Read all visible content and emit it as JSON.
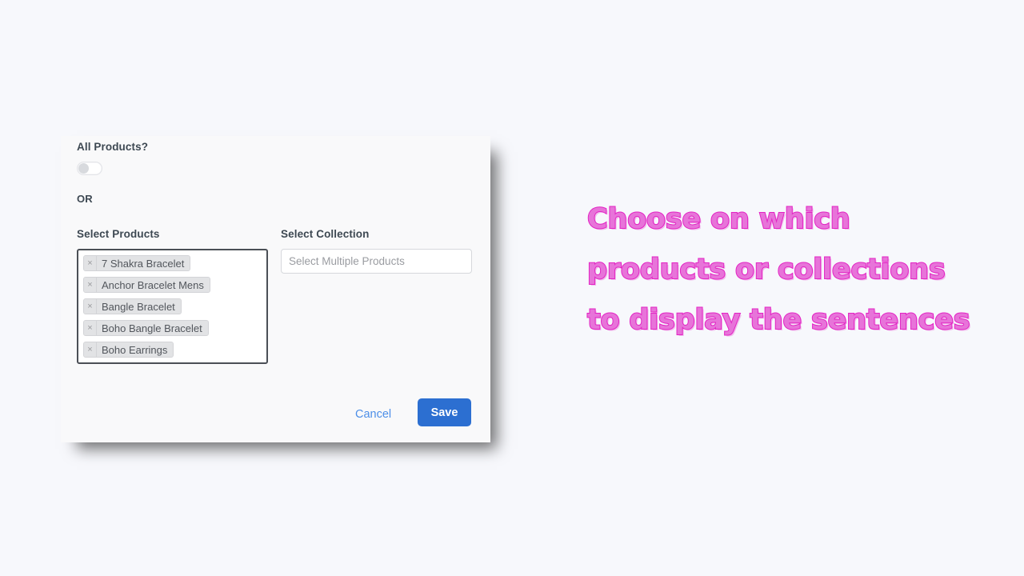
{
  "page": {
    "background_color": "#f7f8fc"
  },
  "modal": {
    "background_color": "#f9f9fa",
    "all_products": {
      "label": "All Products?",
      "toggle_state": "off"
    },
    "or_label": "OR",
    "select_products": {
      "label": "Select Products",
      "tags": [
        {
          "remove_icon": "close-icon",
          "label": "7 Shakra Bracelet"
        },
        {
          "remove_icon": "close-icon",
          "label": "Anchor Bracelet Mens"
        },
        {
          "remove_icon": "close-icon",
          "label": "Bangle Bracelet"
        },
        {
          "remove_icon": "close-icon",
          "label": "Boho Bangle Bracelet"
        },
        {
          "remove_icon": "close-icon",
          "label": "Boho Earrings"
        }
      ]
    },
    "select_collection": {
      "label": "Select Collection",
      "value": "",
      "placeholder": "Select Multiple Products"
    },
    "footer": {
      "cancel_label": "Cancel",
      "save_label": "Save",
      "save_color": "#2c6fd1",
      "cancel_color": "#4d8fe8"
    }
  },
  "caption": {
    "text": "Choose on which products or collections to display the sentences",
    "fill_color": "#e774d9",
    "outline_color": "#e324c4"
  }
}
